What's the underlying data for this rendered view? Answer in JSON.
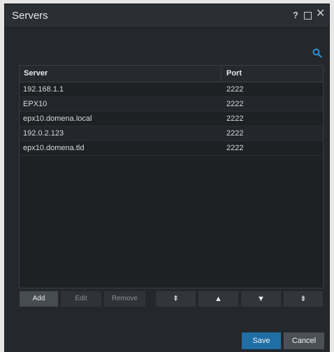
{
  "window": {
    "title": "Servers",
    "help_label": "?",
    "close_label": "✕"
  },
  "table": {
    "columns": {
      "server": "Server",
      "port": "Port"
    },
    "rows": [
      {
        "server": "192.168.1.1",
        "port": "2222"
      },
      {
        "server": "EPX10",
        "port": "2222"
      },
      {
        "server": "epx10.domena.local",
        "port": "2222"
      },
      {
        "server": "192.0.2.123",
        "port": "2222"
      },
      {
        "server": "epx10.domena.tld",
        "port": "2222"
      }
    ]
  },
  "toolbar": {
    "add_label": "Add",
    "edit_label": "Edit",
    "remove_label": "Remove",
    "move_top_label": "⇞",
    "move_up_label": "▲",
    "move_down_label": "▼",
    "move_bottom_label": "⇟"
  },
  "footer": {
    "save_label": "Save",
    "cancel_label": "Cancel"
  },
  "colors": {
    "accent": "#1f6ea6",
    "search_icon": "#2f8fd6"
  },
  "icons": {
    "search": "search-icon",
    "maximize": "maximize-icon",
    "close": "close-icon"
  }
}
